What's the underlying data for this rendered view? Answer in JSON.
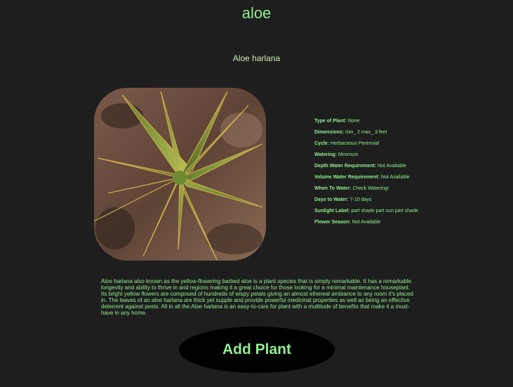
{
  "plant": {
    "common_name": "aloe",
    "scientific_name": "Aloe harlana",
    "image_alt": "aloe"
  },
  "details": [
    {
      "label": "Type of Plant:",
      "value": "None"
    },
    {
      "label": "Dimensions:",
      "value": "min_ 2 max_ 3 feet"
    },
    {
      "label": "Cycle:",
      "value": "Herbaceous Perennial"
    },
    {
      "label": "Watering:",
      "value": "Minimum"
    },
    {
      "label": "Depth Water Requirement:",
      "value": "Not Available"
    },
    {
      "label": "Volume Water Requirement:",
      "value": "Not Available"
    },
    {
      "label": "When To Water:",
      "value": "Check Watering!"
    },
    {
      "label": "Days to Water:",
      "value": "7-10 days"
    },
    {
      "label": "Sunlight Label:",
      "value": "part shade part sun part shade"
    },
    {
      "label": "Flower Season:",
      "value": "Not Available"
    }
  ],
  "description": "Aloe harlana also known as the yellow-flowering barbed aloe is a plant species that is simply remarkable. It has a remarkable longevity and ability to thrive in arid regions making it a great choice for those looking for a minimal maintenance houseplant. Its bright yellow flowers are composed of hundreds of wispy petals giving an almost ethereal ambiance to any room it's placed in. The leaves of an aloe harlana are thick yet supple and provide powerful medicinal properties as well as being an effective deterrent against pests. All in all the Aloe harlana is an easy-to-care for plant with a multitude of benefits that make it a must-have in any home.",
  "actions": {
    "add_label": "Add Plant"
  },
  "colors": {
    "background": "#1e1e1e",
    "accent": "#90ee90",
    "button": "#000000"
  }
}
